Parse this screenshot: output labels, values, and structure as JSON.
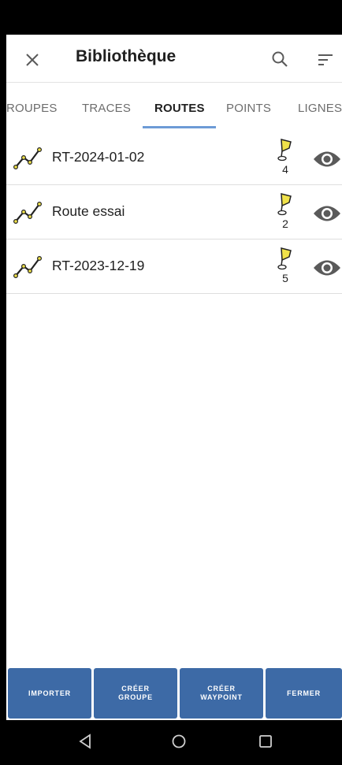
{
  "header": {
    "title": "Bibliothèque",
    "close_icon": "close-icon",
    "search_icon": "search-icon",
    "sort_icon": "sort-icon"
  },
  "tabs": [
    {
      "label": "ROUPES",
      "active": false
    },
    {
      "label": "TRACES",
      "active": false
    },
    {
      "label": "ROUTES",
      "active": true
    },
    {
      "label": "POINTS",
      "active": false
    },
    {
      "label": "LIGNES",
      "active": false
    }
  ],
  "routes": [
    {
      "name": "RT-2024-01-02",
      "waypoints": "4"
    },
    {
      "name": "Route essai",
      "waypoints": "2"
    },
    {
      "name": "RT-2023-12-19",
      "waypoints": "5"
    }
  ],
  "buttons": {
    "import": "IMPORTER",
    "create_group_line1": "CRÉER",
    "create_group_line2": "GROUPE",
    "create_waypoint_line1": "CRÉER",
    "create_waypoint_line2": "WAYPOINT",
    "close": "FERMER"
  },
  "colors": {
    "accent": "#6d9bd6",
    "button": "#3d6aa6",
    "pin": "#f0e24a"
  }
}
